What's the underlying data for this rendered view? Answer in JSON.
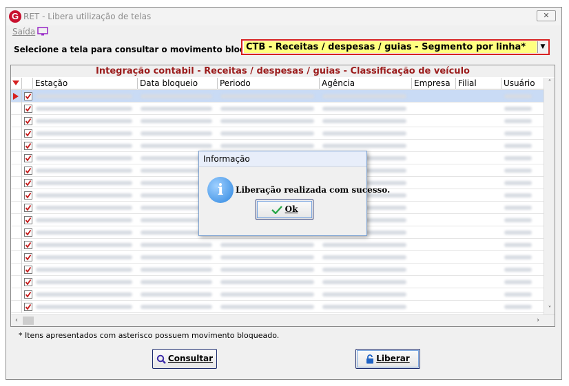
{
  "window": {
    "title": "RET - Libera utilização de telas",
    "close_glyph": "✕"
  },
  "menu": {
    "saida_label": "Saída"
  },
  "selector": {
    "label": "Selecione a tela para consultar o movimento bloqueado :",
    "value": "CTB - Receitas / despesas / guias - Segmento por linha*"
  },
  "grid": {
    "caption": "Integração contabil - Receitas / despesas / guias - Classificação de veículo",
    "columns": [
      "Estação",
      "Data bloqueio",
      "Periodo",
      "Agência",
      "Empresa",
      "Filial",
      "Usuário"
    ],
    "row_count": 18,
    "all_checked": true,
    "selected_row": 0
  },
  "footer": {
    "note": "* Itens apresentados com asterisco possuem movimento bloqueado.",
    "consultar_label": "Consultar",
    "liberar_label": "Liberar"
  },
  "dialog": {
    "title": "Informação",
    "message": "Liberação realizada com sucesso.",
    "ok_label": "Ok"
  },
  "colors": {
    "accent_red": "#d62020",
    "caption_red": "#9b1c1c",
    "combo_yellow": "#ffff80",
    "selection_blue": "#c9dbf5"
  }
}
